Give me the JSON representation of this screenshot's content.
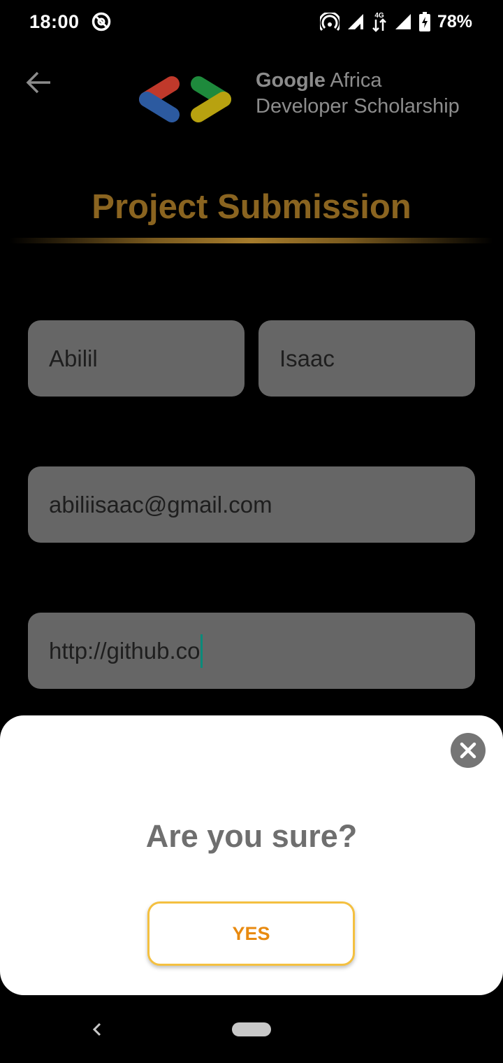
{
  "status_bar": {
    "time": "18:00",
    "network": "4G",
    "battery": "78%",
    "icons": [
      "do-not-disturb-icon",
      "hotspot-icon",
      "signal-icon",
      "data-arrows-icon",
      "battery-charging-icon"
    ]
  },
  "header": {
    "brand_google": "Google",
    "brand_africa": " Africa",
    "brand_line2": "Developer Scholarship",
    "logo_colors": [
      "#c0392b",
      "#2c5aa0",
      "#1e8a3c",
      "#b8a210"
    ]
  },
  "page": {
    "title": "Project Submission",
    "title_color": "#8a6420"
  },
  "form": {
    "first_name": "Abilil",
    "last_name": "Isaac",
    "email": "abiliisaac@gmail.com",
    "github": "http://github.co"
  },
  "dialog": {
    "question": "Are you sure?",
    "confirm_label": "YES",
    "accent_color": "#f4c040"
  }
}
